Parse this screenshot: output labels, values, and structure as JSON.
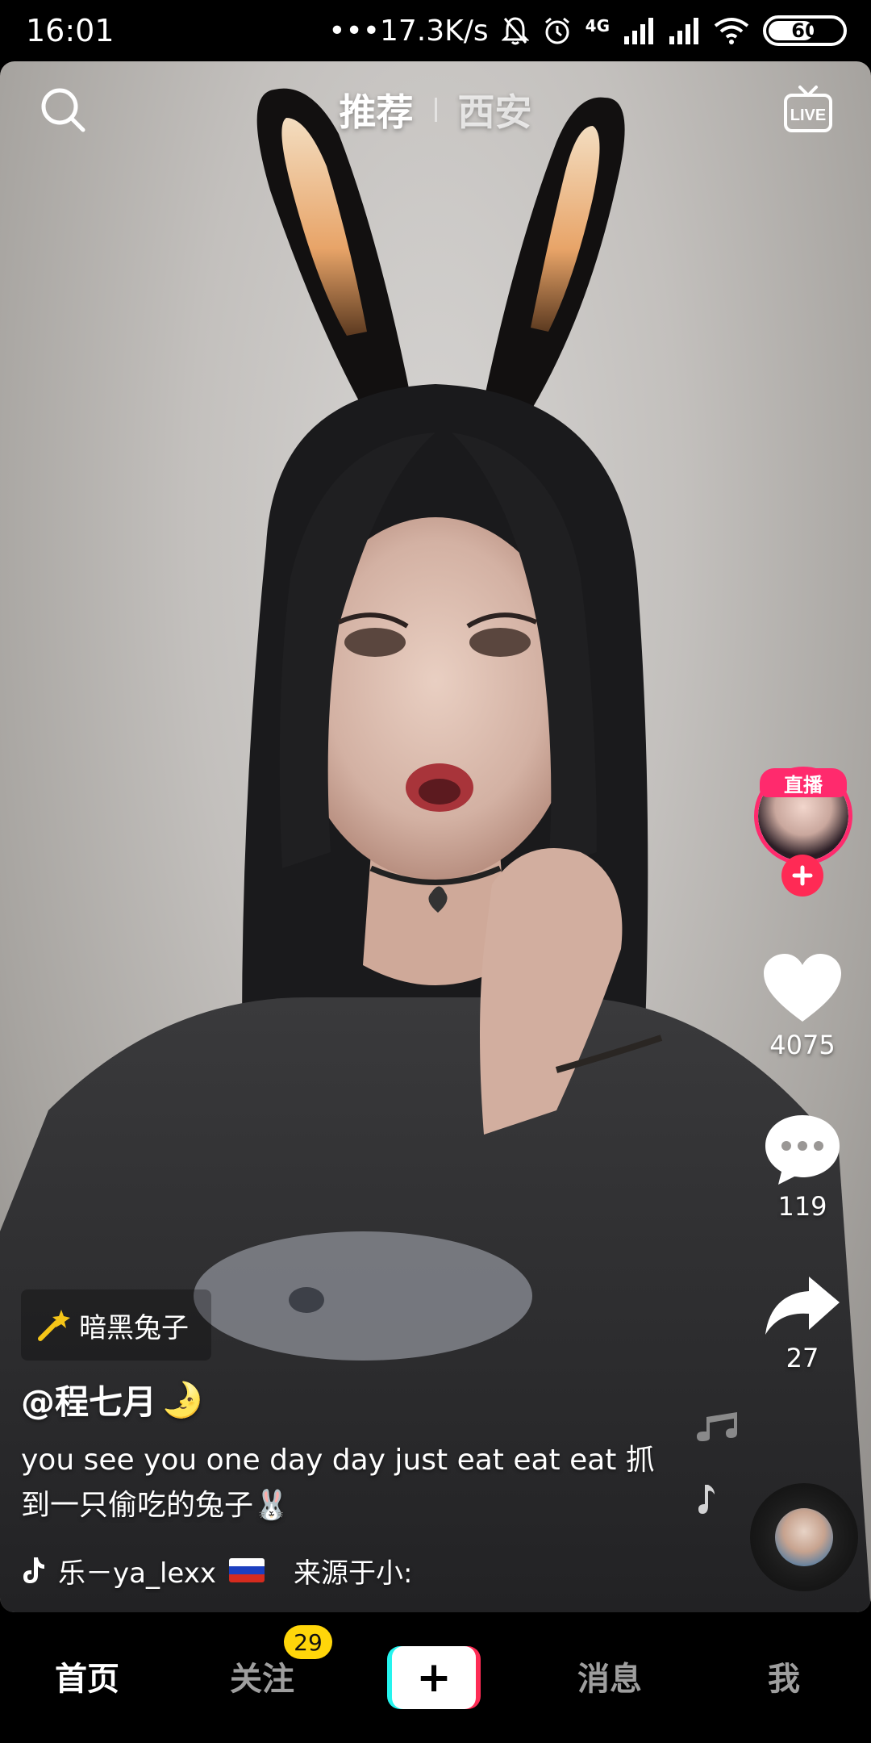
{
  "status_bar": {
    "time": "16:01",
    "network_speed": "•••17.3K/s",
    "network_type": "4G",
    "battery_level": "60"
  },
  "top_nav": {
    "tabs": [
      {
        "label": "推荐",
        "active": true
      },
      {
        "label": "西安",
        "active": false
      }
    ],
    "search_icon": "search-icon",
    "live_icon": "live-tv-icon"
  },
  "video": {
    "effect_tag": "暗黑兔子",
    "author": "@程七月",
    "author_emoji": "🌛",
    "caption": "you see you one day day just eat eat eat 抓到一只偷吃的兔子🐰",
    "music": "乐－ya_lexx 🇷🇺",
    "music_title": "乐－ya_lexx",
    "music_source": "来源于小:"
  },
  "right_rail": {
    "live_badge": "直播",
    "likes": "4075",
    "comments": "119",
    "shares": "27"
  },
  "bottom_nav": {
    "items": [
      {
        "label": "首页",
        "active": true
      },
      {
        "label": "关注",
        "active": false,
        "badge": "29"
      },
      {
        "label": "+",
        "active": false
      },
      {
        "label": "消息",
        "active": false
      },
      {
        "label": "我",
        "active": false
      }
    ]
  },
  "colors": {
    "accent_pink": "#fe2c55",
    "accent_cyan": "#25f4ee",
    "badge_yellow": "#ffd60a",
    "live_ring": "#ff2a6d"
  }
}
